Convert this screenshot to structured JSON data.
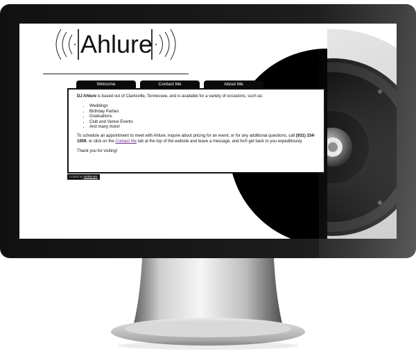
{
  "site": {
    "logo_text": "Ahlure",
    "nav": [
      {
        "label": "Welcome"
      },
      {
        "label": "Contact Me"
      },
      {
        "label": "About Me"
      }
    ],
    "intro": {
      "name": "DJ Ahlure",
      "text": " is based out of Clarksville, Tennessee, and is available for a variety of occasions, such as:"
    },
    "occasions": [
      "Weddings",
      "Birthday Parties",
      "Graduations",
      "Club and Venue Events",
      "And many more!"
    ],
    "schedule": {
      "part1": "To schedule an appointment to meet with Ahlure, inquire about pricing for an event, or for any additional questions, call ",
      "phone": "(931) 334-1009",
      "part2": ", or click on the ",
      "link": "Contact Me",
      "part3": " tab at the top of the website and leave a message, and he'll get back to you expeditiously."
    },
    "thanks": "Thank you for visiting!",
    "credit": {
      "prefix": "Coded by ",
      "author": "NickBurks"
    }
  },
  "colors": {
    "bezel": "#111111",
    "tab": "#0b0b0b",
    "link": "#6b2a92",
    "speaker": "#000000"
  }
}
